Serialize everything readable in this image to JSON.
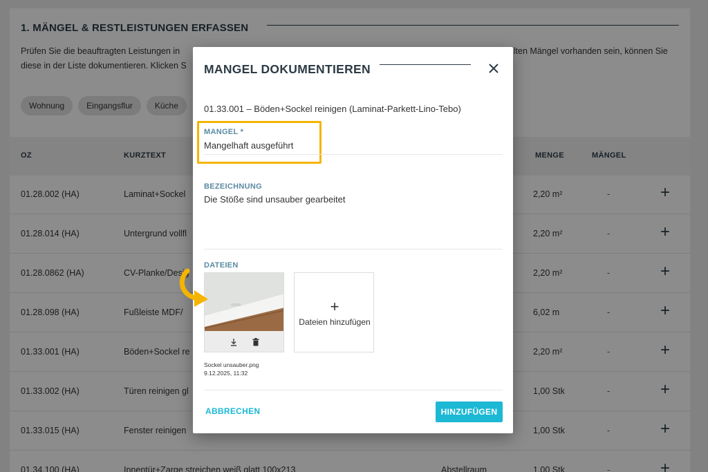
{
  "section": {
    "title": "1. MÄNGEL & RESTLEISTUNGEN ERFASSEN",
    "intro_line1_left": "Prüfen Sie die beauftragten Leistungen in",
    "intro_line1_right": "llten Mängel vorhanden sein, können Sie",
    "intro_line2_left": "diese in der Liste dokumentieren. Klicken S"
  },
  "chips": [
    "Wohnung",
    "Eingangsflur",
    "Küche"
  ],
  "table": {
    "headers": {
      "oz": "OZ",
      "kurztext": "KURZTEXT",
      "menge": "MENGE",
      "maengel": "MÄNGEL"
    },
    "rows": [
      {
        "oz": "01.28.002 (HA)",
        "kurztext": "Laminat+Sockel",
        "raum": "",
        "menge": "2,20 m²",
        "maengel": "-"
      },
      {
        "oz": "01.28.014 (HA)",
        "kurztext": "Untergrund vollfl",
        "raum": "",
        "menge": "2,20 m²",
        "maengel": "-"
      },
      {
        "oz": "01.28.0862 (HA)",
        "kurztext": "CV-Planke/Desig",
        "raum": "",
        "menge": "2,20 m²",
        "maengel": "-"
      },
      {
        "oz": "01.28.098 (HA)",
        "kurztext": "Fußleiste MDF/",
        "raum": "",
        "menge": "6,02 m",
        "maengel": "-"
      },
      {
        "oz": "01.33.001 (HA)",
        "kurztext": "Böden+Sockel re",
        "raum": "",
        "menge": "2,20 m²",
        "maengel": "-"
      },
      {
        "oz": "01.33.002 (HA)",
        "kurztext": "Türen reinigen gl",
        "raum": "",
        "menge": "1,00 Stk",
        "maengel": "-"
      },
      {
        "oz": "01.33.015 (HA)",
        "kurztext": "Fenster reinigen",
        "raum": "",
        "menge": "1,00 Stk",
        "maengel": "-"
      },
      {
        "oz": "01.34.100 (HA)",
        "kurztext": "Innentür+Zarge streichen weiß glatt 100x213",
        "raum": "Abstellraum",
        "menge": "1,00 Stk",
        "maengel": "-"
      }
    ],
    "add_symbol": "+"
  },
  "modal": {
    "title": "MANGEL DOKUMENTIEREN",
    "position": "01.33.001 – Böden+Sockel reinigen (Laminat-Parkett-Lino-Tebo)",
    "mangel_label": "MANGEL *",
    "mangel_value": "Mangelhaft ausgeführt",
    "bezeichnung_label": "BEZEICHNUNG",
    "bezeichnung_value": "Die Stöße sind unsauber gearbeitet",
    "dateien_label": "DATEIEN",
    "file": {
      "name": "Sockel unsauber.png",
      "date": "9.12.2025, 11:32"
    },
    "add_files_symbol": "+",
    "add_files_label": "Dateien hinzufügen",
    "cancel_label": "ABBRECHEN",
    "submit_label": "HINZUFÜGEN"
  },
  "colors": {
    "accent": "#1cb8d4",
    "highlight": "#f4b400",
    "title": "#2d3b45",
    "label": "#5a8aa2"
  },
  "icons": [
    "close-icon",
    "download-icon",
    "trash-icon",
    "plus-icon",
    "arrow-icon"
  ]
}
